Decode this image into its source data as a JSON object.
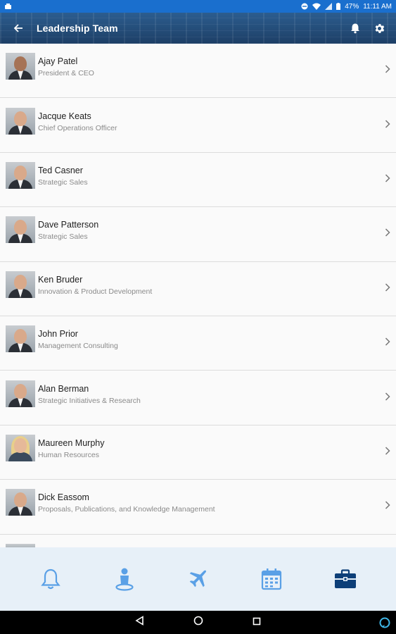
{
  "status_bar": {
    "battery": "47%",
    "time": "11:11 AM"
  },
  "app_bar": {
    "title": "Leadership Team",
    "icons": [
      "back-arrow-icon",
      "bell-icon",
      "gear-icon"
    ]
  },
  "leaders": [
    {
      "name": "Ajay Patel",
      "role": "President & CEO"
    },
    {
      "name": "Jacque Keats",
      "role": "Chief Operations Officer"
    },
    {
      "name": "Ted Casner",
      "role": "Strategic Sales"
    },
    {
      "name": "Dave Patterson",
      "role": "Strategic Sales"
    },
    {
      "name": "Ken Bruder",
      "role": "Innovation & Product Development"
    },
    {
      "name": "John Prior",
      "role": "Management Consulting"
    },
    {
      "name": "Alan Berman",
      "role": "Strategic Initiatives & Research"
    },
    {
      "name": "Maureen Murphy",
      "role": "Human Resources"
    },
    {
      "name": "Dick Eassom",
      "role": "Proposals, Publications, and Knowledge Management"
    }
  ],
  "bottom_nav": {
    "items": [
      "bell-icon",
      "person-pin-icon",
      "airplane-icon",
      "calendar-icon",
      "briefcase-icon"
    ],
    "active": "briefcase-icon",
    "colors": {
      "inactive": "#5aa0e6",
      "active": "#0d3f78"
    }
  },
  "system_nav": [
    "back-triangle-icon",
    "home-circle-icon",
    "recents-square-icon",
    "alexa-icon"
  ]
}
